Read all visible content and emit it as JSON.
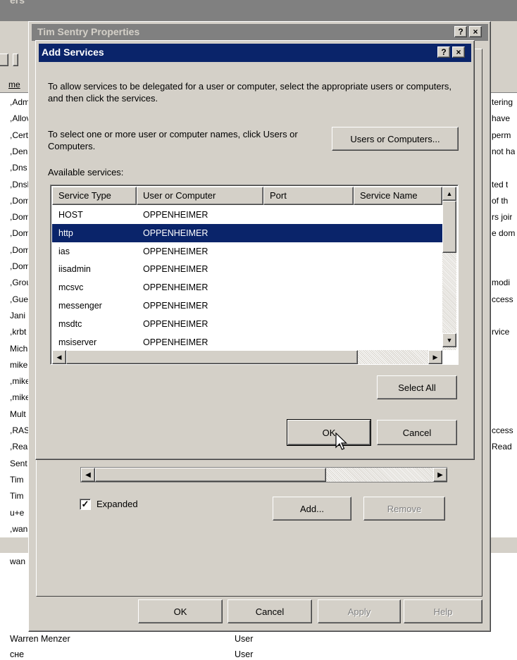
{
  "background": {
    "top_title_fragment": "ers",
    "column_header": "me",
    "rows": [
      ",Adm",
      ",Allov",
      ",Cert",
      ",Den",
      ",Dns",
      ",Dnsl",
      ",Dom",
      ",Dom",
      ",Dom",
      ",Dom",
      ",Dom",
      ",Grou",
      ",Gue",
      "Jani",
      ",krbt",
      "Mich",
      "mike",
      ",mike",
      ",mike",
      "Mult",
      ",RAS",
      ",Rea",
      "Sent",
      "Tim",
      "Tim",
      "u+e",
      ",wan",
      ",wan",
      "wan"
    ],
    "right_fragments": [
      "tering",
      "have",
      "perm",
      "not ha",
      "",
      "ted t",
      "of th",
      "rs joir",
      "e dom",
      "",
      "",
      "modi",
      "ccess",
      "",
      "rvice",
      "",
      "",
      "",
      "",
      "",
      "ccess",
      "Read"
    ],
    "bottom_rows": [
      {
        "name": "Warren Menzer",
        "type": "User"
      },
      {
        "name": "сне",
        "type": "User"
      }
    ]
  },
  "properties_dialog": {
    "title": "Tim Sentry Properties",
    "help_button": "?",
    "close_button": "×",
    "expanded_label": "Expanded",
    "expanded_checked": true,
    "add_button": "Add...",
    "remove_button": "Remove",
    "ok_button": "OK",
    "cancel_button": "Cancel",
    "apply_button": "Apply",
    "help_footer_button": "Help"
  },
  "add_services_dialog": {
    "title": "Add Services",
    "help_button": "?",
    "close_button": "×",
    "intro_text": "To allow services to be delegated for a user or computer, select the appropriate users or computers, and then click the services.",
    "select_text": "To select one or more user or computer names, click Users or Computers.",
    "users_or_computers_button": "Users or Computers...",
    "available_services_label": "Available services:",
    "columns": [
      "Service Type",
      "User or Computer",
      "Port",
      "Service Name"
    ],
    "services": [
      {
        "type": "HOST",
        "computer": "OPPENHEIMER",
        "port": "",
        "name": ""
      },
      {
        "type": "http",
        "computer": "OPPENHEIMER",
        "port": "",
        "name": "",
        "selected": true
      },
      {
        "type": "ias",
        "computer": "OPPENHEIMER",
        "port": "",
        "name": ""
      },
      {
        "type": "iisadmin",
        "computer": "OPPENHEIMER",
        "port": "",
        "name": ""
      },
      {
        "type": "mcsvc",
        "computer": "OPPENHEIMER",
        "port": "",
        "name": ""
      },
      {
        "type": "messenger",
        "computer": "OPPENHEIMER",
        "port": "",
        "name": ""
      },
      {
        "type": "msdtc",
        "computer": "OPPENHEIMER",
        "port": "",
        "name": ""
      },
      {
        "type": "msiserver",
        "computer": "OPPENHEIMER",
        "port": "",
        "name": ""
      }
    ],
    "select_all_button": "Select All",
    "ok_button": "OK",
    "cancel_button": "Cancel"
  },
  "colors": {
    "active_title": "#0a246a",
    "inactive_title": "#808080",
    "selection": "#0a246a",
    "face": "#d4d0c8"
  }
}
